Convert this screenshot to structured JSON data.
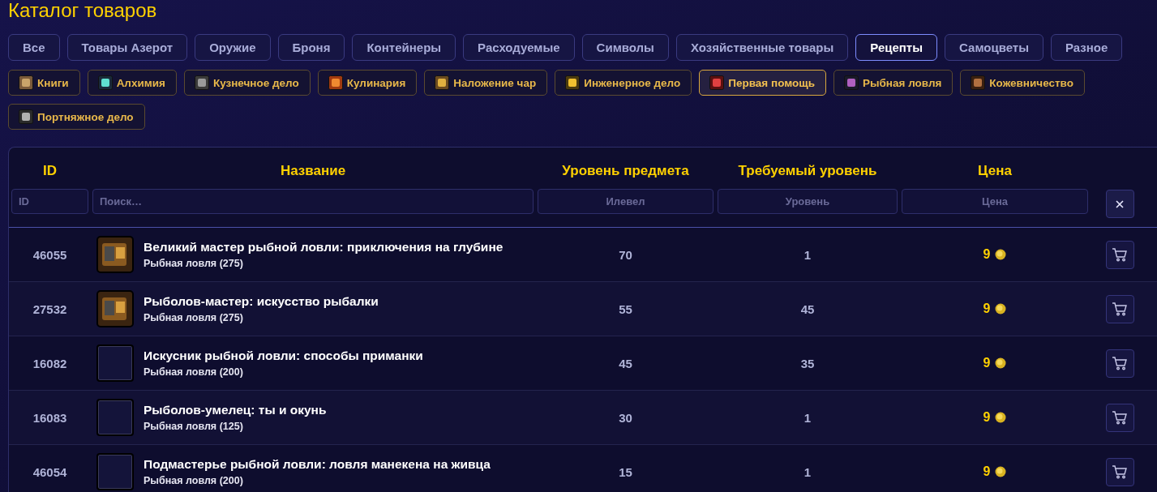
{
  "title": "Каталог товаров",
  "categories": [
    {
      "label": "Все",
      "selected": false
    },
    {
      "label": "Товары Азерот",
      "selected": false
    },
    {
      "label": "Оружие",
      "selected": false
    },
    {
      "label": "Броня",
      "selected": false
    },
    {
      "label": "Контейнеры",
      "selected": false
    },
    {
      "label": "Расходуемые",
      "selected": false
    },
    {
      "label": "Символы",
      "selected": false
    },
    {
      "label": "Хозяйственные товары",
      "selected": false
    },
    {
      "label": "Рецепты",
      "selected": true
    },
    {
      "label": "Самоцветы",
      "selected": false
    },
    {
      "label": "Разное",
      "selected": false
    }
  ],
  "professions": [
    {
      "label": "Книги",
      "selected": false
    },
    {
      "label": "Алхимия",
      "selected": false
    },
    {
      "label": "Кузнечное дело",
      "selected": false
    },
    {
      "label": "Кулинария",
      "selected": false
    },
    {
      "label": "Наложение чар",
      "selected": false
    },
    {
      "label": "Инженерное дело",
      "selected": false
    },
    {
      "label": "Первая помощь",
      "selected": true
    },
    {
      "label": "Рыбная ловля",
      "selected": false
    },
    {
      "label": "Кожевничество",
      "selected": false
    },
    {
      "label": "Портняжное дело",
      "selected": false
    }
  ],
  "table": {
    "columns": [
      "ID",
      "Название",
      "Уровень предмета",
      "Требуемый уровень",
      "Цена"
    ],
    "filters": [
      {
        "placeholder": "ID"
      },
      {
        "placeholder": "Поиск…"
      },
      {
        "placeholder": "Илевел"
      },
      {
        "placeholder": "Уровень"
      },
      {
        "placeholder": "Цена"
      }
    ],
    "rows": [
      {
        "id": "46055",
        "icon": true,
        "name": "Великий мастер рыбной ловли: приключения на глубине",
        "skill": "Рыбная ловля (275)",
        "item_level": "70",
        "required_level": "1",
        "price": "9"
      },
      {
        "id": "27532",
        "icon": true,
        "name": "Рыболов-мастер: искусство рыбалки",
        "skill": "Рыбная ловля (275)",
        "item_level": "55",
        "required_level": "45",
        "price": "9"
      },
      {
        "id": "16082",
        "icon": false,
        "name": "Искусник рыбной ловли: способы приманки",
        "skill": "Рыбная ловля (200)",
        "item_level": "45",
        "required_level": "35",
        "price": "9"
      },
      {
        "id": "16083",
        "icon": false,
        "name": "Рыболов-умелец: ты и окунь",
        "skill": "Рыбная ловля (125)",
        "item_level": "30",
        "required_level": "1",
        "price": "9"
      },
      {
        "id": "46054",
        "icon": false,
        "name": "Подмастерье рыбной ловли: ловля манекена на живца",
        "skill": "Рыбная ловля (200)",
        "item_level": "15",
        "required_level": "1",
        "price": "9"
      }
    ]
  }
}
